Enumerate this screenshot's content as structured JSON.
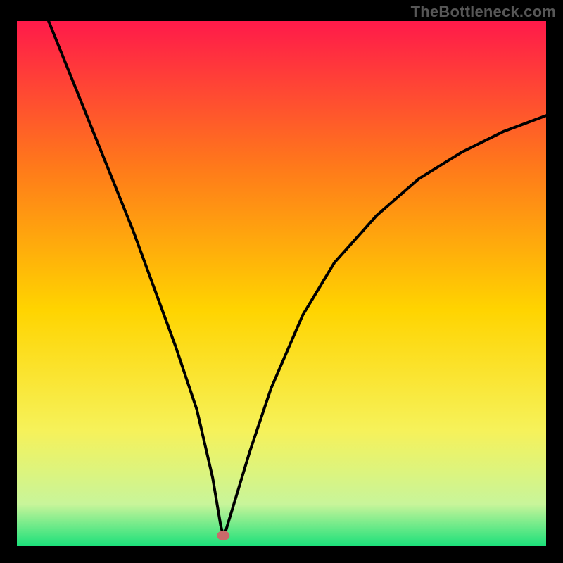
{
  "watermark": "TheBottleneck.com",
  "chart_data": {
    "type": "line",
    "title": "",
    "xlabel": "",
    "ylabel": "",
    "xlim": [
      0,
      100
    ],
    "ylim": [
      0,
      100
    ],
    "grid": false,
    "legend": false,
    "annotations": [],
    "gradient_colors": {
      "top": "#ff1a4a",
      "upper_mid": "#ff7a1a",
      "mid": "#ffd400",
      "lower_mid": "#f6f25a",
      "near_bottom": "#c8f59a",
      "bottom_band": "#1be07a"
    },
    "optimum_marker": {
      "x": 39,
      "y": 2,
      "color": "#c96a6a"
    },
    "series": [
      {
        "name": "bottleneck-curve",
        "color": "#000000",
        "x": [
          6,
          10,
          14,
          18,
          22,
          26,
          30,
          34,
          37,
          38.5,
          39,
          39.5,
          41,
          44,
          48,
          54,
          60,
          68,
          76,
          84,
          92,
          100
        ],
        "values": [
          100,
          90,
          80,
          70,
          60,
          49,
          38,
          26,
          13,
          4,
          2,
          3,
          8,
          18,
          30,
          44,
          54,
          63,
          70,
          75,
          79,
          82
        ]
      }
    ],
    "notes": "Axes unlabeled in source image; x/y normalized 0–100 across the colored plot region. Curve values are read from pixel positions against the gradient; no numeric tick labels are rendered."
  },
  "colors": {
    "frame": "#000000",
    "watermark": "#575757"
  }
}
